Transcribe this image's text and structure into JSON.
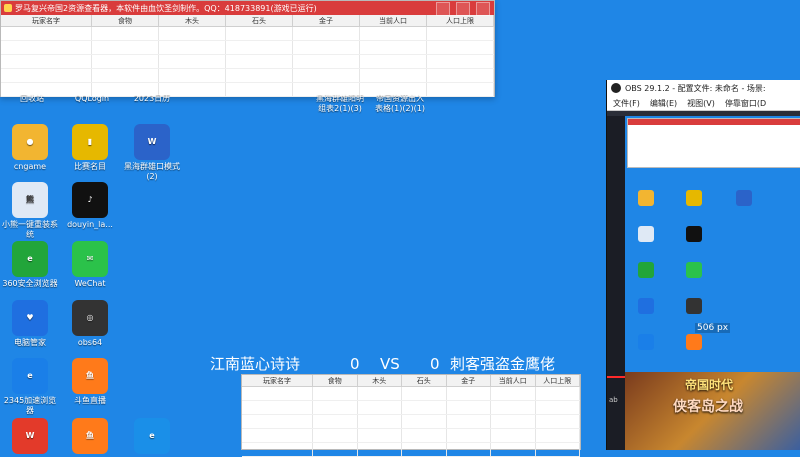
{
  "top_window": {
    "title": "罗马复兴帝国2资源查看器，本软件由血饮圣剑制作。QQ：418733891(游戏已运行)",
    "columns": [
      "玩家名字",
      "食物",
      "木头",
      "石头",
      "金子",
      "当前人口",
      "人口上限"
    ]
  },
  "desktop": {
    "partial_labels": [
      {
        "text": "回收站"
      },
      {
        "text": "QQLogin"
      },
      {
        "text": "2023日历"
      },
      {
        "text": "黑海群雄阳明"
      },
      {
        "text": "帝国资源出入"
      },
      {
        "text": "组表2(1)(3)"
      },
      {
        "text": "表格(1)(2)(1)"
      }
    ],
    "icons": [
      {
        "label": "cngame",
        "color": "#f2b531",
        "glyph": "●"
      },
      {
        "label": "比赛名目",
        "color": "#e6b800",
        "glyph": "▮"
      },
      {
        "label": "黑海群雄口模式(2)",
        "color": "#2b63c9",
        "glyph": "W"
      },
      {
        "label": "小熊一键重装系统",
        "color": "#dfe9f5",
        "glyph": "熊"
      },
      {
        "label": "douyin_la...",
        "color": "#111111",
        "glyph": "♪"
      },
      {
        "label": "360安全浏览器",
        "color": "#22a53a",
        "glyph": "e"
      },
      {
        "label": "WeChat",
        "color": "#2bc24a",
        "glyph": "✉"
      },
      {
        "label": "电脑管家",
        "color": "#1f6fe0",
        "glyph": "♥"
      },
      {
        "label": "obs64",
        "color": "#333333",
        "glyph": "◎"
      },
      {
        "label": "2345加速浏览器",
        "color": "#1a7fe8",
        "glyph": "e"
      },
      {
        "label": "斗鱼直播",
        "color": "#ff7a1a",
        "glyph": "鱼"
      },
      {
        "label": "",
        "color": "#e33a2a",
        "glyph": "W"
      },
      {
        "label": "",
        "color": "#ff7a1a",
        "glyph": "鱼"
      },
      {
        "label": "",
        "color": "#1a8fe8",
        "glyph": "e"
      }
    ]
  },
  "match_bar": {
    "left_player": "江南蓝心诗诗",
    "left_score": "0",
    "vs": "VS",
    "right_score": "0",
    "right_player": "刺客强盗金鹰佬"
  },
  "bottom_window": {
    "columns": [
      "玩家名字",
      "食物",
      "木头",
      "石头",
      "金子",
      "当前人口",
      "人口上限"
    ]
  },
  "obs": {
    "title": "OBS 29.1.2 - 配置文件: 未命名 - 场景: ",
    "menu": [
      "文件(F)",
      "编辑(E)",
      "视图(V)",
      "停靠窗口(D"
    ],
    "px_label": "506 px",
    "ad_title": "帝国时代",
    "ad_subtitle": "侠客岛之战",
    "strip_text": "ab"
  }
}
